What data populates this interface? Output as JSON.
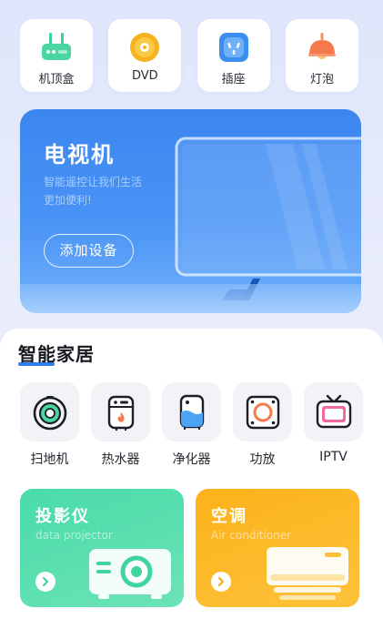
{
  "devices_top": [
    {
      "label": "机顶盒",
      "icon": "set-top-box-icon"
    },
    {
      "label": "DVD",
      "icon": "dvd-disc-icon"
    },
    {
      "label": "插座",
      "icon": "socket-icon"
    },
    {
      "label": "灯泡",
      "icon": "lamp-icon"
    }
  ],
  "tv_banner": {
    "title": "电视机",
    "subtitle_line1": "智能遥控让我们生活",
    "subtitle_line2": "更加便利!",
    "button_label": "添加设备"
  },
  "smart_home": {
    "title": "智能家居",
    "items": [
      {
        "label": "扫地机",
        "icon": "robot-vacuum-icon"
      },
      {
        "label": "热水器",
        "icon": "water-heater-icon"
      },
      {
        "label": "净化器",
        "icon": "air-purifier-icon"
      },
      {
        "label": "功放",
        "icon": "amplifier-icon"
      },
      {
        "label": "IPTV",
        "icon": "iptv-icon"
      }
    ]
  },
  "cards": [
    {
      "title": "投影仪",
      "subtitle": "data projector",
      "icon": "projector-icon",
      "color": "#4fdcab"
    },
    {
      "title": "空调",
      "subtitle": "Air conditioner",
      "icon": "air-conditioner-icon",
      "color": "#fcb51f"
    }
  ],
  "colors": {
    "accent": "#2f7df0",
    "tv_banner": "#3f8bf2"
  }
}
